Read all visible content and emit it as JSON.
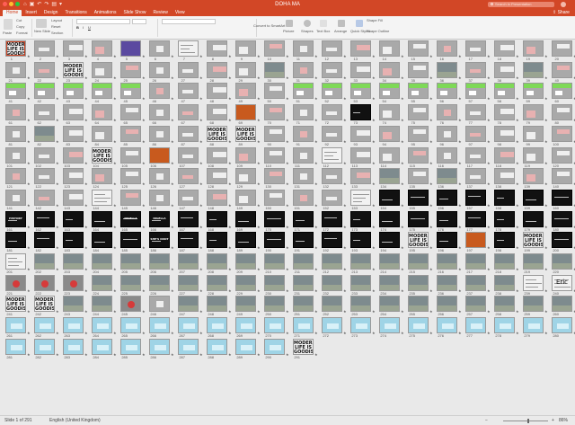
{
  "window": {
    "title": "DOHA MA",
    "search_placeholder": "Search in Presentation",
    "qat_icons": [
      "home-icon",
      "save-icon",
      "undo-icon",
      "redo-icon",
      "print-icon",
      "more-icon"
    ]
  },
  "tabs": [
    "Home",
    "Insert",
    "Design",
    "Transitions",
    "Animations",
    "Slide Show",
    "Review",
    "View"
  ],
  "active_tab": "Home",
  "share_label": "Share",
  "ribbon": {
    "paste": "Paste",
    "cut": "Cut",
    "copy": "Copy",
    "format": "Format",
    "new_slide": "New Slide",
    "layout": "Layout",
    "reset": "Reset",
    "section": "Section",
    "convert_smartart": "Convert to SmartArt",
    "picture": "Picture",
    "shapes": "Shapes",
    "text_box": "Text Box",
    "arrange": "Arrange",
    "quick_styles": "Quick Styles",
    "shape_fill": "Shape Fill",
    "shape_outline": "Shape Outline"
  },
  "status": {
    "slide_info": "Slide 1 of 291",
    "language": "English (United Kingdom)",
    "zoom": "86%",
    "zoom_fraction": 0.55
  },
  "thumb_style": {
    "gray": "#a9a9a9",
    "dark": "#111111",
    "green": "#7ed957",
    "orange": "#c85a1e",
    "blue": "#9fd4e6",
    "white": "#f2f2f2",
    "red": "#d63a3a"
  },
  "slides": [
    {
      "num": "1",
      "t": "modern"
    },
    {
      "num": "2",
      "t": "gray"
    },
    {
      "num": "3",
      "t": "gray"
    },
    {
      "num": "4",
      "t": "gray"
    },
    {
      "num": "5",
      "t": "purple"
    },
    {
      "num": "6",
      "t": "gray"
    },
    {
      "num": "7",
      "t": "white"
    },
    {
      "num": "8",
      "t": "gray"
    },
    {
      "num": "9",
      "t": "gray"
    },
    {
      "num": "10",
      "t": "gray"
    },
    {
      "num": "11",
      "t": "gray"
    },
    {
      "num": "12",
      "t": "gray"
    },
    {
      "num": "13",
      "t": "gray"
    },
    {
      "num": "14",
      "t": "gray"
    },
    {
      "num": "15",
      "t": "gray"
    },
    {
      "num": "16",
      "t": "gray"
    },
    {
      "num": "17",
      "t": "gray"
    },
    {
      "num": "18",
      "t": "gray"
    },
    {
      "num": "19",
      "t": "gray"
    },
    {
      "num": "20",
      "t": "gray"
    },
    {
      "num": "21",
      "t": "gray"
    },
    {
      "num": "22",
      "t": "gray"
    },
    {
      "num": "23",
      "t": "modern"
    },
    {
      "num": "24",
      "t": "gray"
    },
    {
      "num": "25",
      "t": "gray"
    },
    {
      "num": "26",
      "t": "gray"
    },
    {
      "num": "27",
      "t": "gray"
    },
    {
      "num": "28",
      "t": "gray"
    },
    {
      "num": "29",
      "t": "gray"
    },
    {
      "num": "30",
      "t": "photo"
    },
    {
      "num": "31",
      "t": "gray"
    },
    {
      "num": "32",
      "t": "gray"
    },
    {
      "num": "33",
      "t": "gray"
    },
    {
      "num": "34",
      "t": "gray"
    },
    {
      "num": "35",
      "t": "gray"
    },
    {
      "num": "36",
      "t": "photo"
    },
    {
      "num": "37",
      "t": "gray"
    },
    {
      "num": "38",
      "t": "gray"
    },
    {
      "num": "39",
      "t": "photo"
    },
    {
      "num": "40",
      "t": "gray"
    },
    {
      "num": "41",
      "t": "green"
    },
    {
      "num": "42",
      "t": "green"
    },
    {
      "num": "43",
      "t": "green"
    },
    {
      "num": "44",
      "t": "green"
    },
    {
      "num": "45",
      "t": "green"
    },
    {
      "num": "46",
      "t": "gray"
    },
    {
      "num": "47",
      "t": "gray"
    },
    {
      "num": "48",
      "t": "gray"
    },
    {
      "num": "49",
      "t": "gray"
    },
    {
      "num": "50",
      "t": "gray"
    },
    {
      "num": "51",
      "t": "green"
    },
    {
      "num": "52",
      "t": "green"
    },
    {
      "num": "53",
      "t": "green"
    },
    {
      "num": "54",
      "t": "green"
    },
    {
      "num": "55",
      "t": "green"
    },
    {
      "num": "56",
      "t": "green"
    },
    {
      "num": "57",
      "t": "green"
    },
    {
      "num": "58",
      "t": "green"
    },
    {
      "num": "59",
      "t": "green"
    },
    {
      "num": "60",
      "t": "green"
    },
    {
      "num": "61",
      "t": "gray"
    },
    {
      "num": "62",
      "t": "gray"
    },
    {
      "num": "63",
      "t": "gray"
    },
    {
      "num": "64",
      "t": "gray"
    },
    {
      "num": "65",
      "t": "gray"
    },
    {
      "num": "66",
      "t": "gray"
    },
    {
      "num": "67",
      "t": "gray"
    },
    {
      "num": "68",
      "t": "gray"
    },
    {
      "num": "69",
      "t": "orange"
    },
    {
      "num": "70",
      "t": "gray"
    },
    {
      "num": "71",
      "t": "gray"
    },
    {
      "num": "72",
      "t": "gray"
    },
    {
      "num": "73",
      "t": "dark"
    },
    {
      "num": "74",
      "t": "gray"
    },
    {
      "num": "75",
      "t": "gray"
    },
    {
      "num": "76",
      "t": "gray"
    },
    {
      "num": "77",
      "t": "gray"
    },
    {
      "num": "78",
      "t": "gray"
    },
    {
      "num": "79",
      "t": "gray"
    },
    {
      "num": "80",
      "t": "gray"
    },
    {
      "num": "81",
      "t": "gray"
    },
    {
      "num": "82",
      "t": "photo"
    },
    {
      "num": "83",
      "t": "gray"
    },
    {
      "num": "84",
      "t": "gray"
    },
    {
      "num": "85",
      "t": "gray"
    },
    {
      "num": "86",
      "t": "gray"
    },
    {
      "num": "87",
      "t": "gray"
    },
    {
      "num": "88",
      "t": "modern"
    },
    {
      "num": "89",
      "t": "modern"
    },
    {
      "num": "90",
      "t": "gray"
    },
    {
      "num": "91",
      "t": "gray"
    },
    {
      "num": "92",
      "t": "gray"
    },
    {
      "num": "93",
      "t": "gray"
    },
    {
      "num": "94",
      "t": "gray"
    },
    {
      "num": "95",
      "t": "gray"
    },
    {
      "num": "96",
      "t": "gray"
    },
    {
      "num": "97",
      "t": "gray"
    },
    {
      "num": "98",
      "t": "gray"
    },
    {
      "num": "99",
      "t": "gray"
    },
    {
      "num": "100",
      "t": "gray"
    },
    {
      "num": "101",
      "t": "gray"
    },
    {
      "num": "102",
      "t": "gray"
    },
    {
      "num": "103",
      "t": "gray"
    },
    {
      "num": "104",
      "t": "modern"
    },
    {
      "num": "105",
      "t": "gray"
    },
    {
      "num": "106",
      "t": "orange"
    },
    {
      "num": "107",
      "t": "gray"
    },
    {
      "num": "108",
      "t": "gray"
    },
    {
      "num": "109",
      "t": "gray"
    },
    {
      "num": "110",
      "t": "gray"
    },
    {
      "num": "111",
      "t": "gray"
    },
    {
      "num": "112",
      "t": "white"
    },
    {
      "num": "113",
      "t": "gray"
    },
    {
      "num": "114",
      "t": "gray"
    },
    {
      "num": "115",
      "t": "gray"
    },
    {
      "num": "116",
      "t": "gray"
    },
    {
      "num": "117",
      "t": "gray"
    },
    {
      "num": "118",
      "t": "gray"
    },
    {
      "num": "119",
      "t": "gray"
    },
    {
      "num": "120",
      "t": "gray"
    },
    {
      "num": "121",
      "t": "gray"
    },
    {
      "num": "122",
      "t": "gray"
    },
    {
      "num": "123",
      "t": "gray"
    },
    {
      "num": "124",
      "t": "gray"
    },
    {
      "num": "125",
      "t": "gray"
    },
    {
      "num": "126",
      "t": "gray"
    },
    {
      "num": "127",
      "t": "gray"
    },
    {
      "num": "128",
      "t": "gray"
    },
    {
      "num": "129",
      "t": "gray"
    },
    {
      "num": "130",
      "t": "gray"
    },
    {
      "num": "131",
      "t": "gray"
    },
    {
      "num": "132",
      "t": "gray"
    },
    {
      "num": "133",
      "t": "gray"
    },
    {
      "num": "134",
      "t": "photo"
    },
    {
      "num": "135",
      "t": "gray"
    },
    {
      "num": "136",
      "t": "photo"
    },
    {
      "num": "137",
      "t": "gray"
    },
    {
      "num": "138",
      "t": "gray"
    },
    {
      "num": "139",
      "t": "gray"
    },
    {
      "num": "140",
      "t": "gray"
    },
    {
      "num": "141",
      "t": "gray"
    },
    {
      "num": "142",
      "t": "gray"
    },
    {
      "num": "143",
      "t": "gray"
    },
    {
      "num": "144",
      "t": "white"
    },
    {
      "num": "145",
      "t": "gray"
    },
    {
      "num": "146",
      "t": "gray"
    },
    {
      "num": "147",
      "t": "gray"
    },
    {
      "num": "148",
      "t": "gray"
    },
    {
      "num": "149",
      "t": "gray"
    },
    {
      "num": "150",
      "t": "gray"
    },
    {
      "num": "151",
      "t": "gray"
    },
    {
      "num": "152",
      "t": "gray"
    },
    {
      "num": "153",
      "t": "white"
    },
    {
      "num": "154",
      "t": "dark"
    },
    {
      "num": "155",
      "t": "dark"
    },
    {
      "num": "156",
      "t": "dark"
    },
    {
      "num": "157",
      "t": "dark"
    },
    {
      "num": "158",
      "t": "dark"
    },
    {
      "num": "159",
      "t": "dark"
    },
    {
      "num": "160",
      "t": "dark"
    },
    {
      "num": "161",
      "t": "dark",
      "txt": "HISTORY"
    },
    {
      "num": "162",
      "t": "dark"
    },
    {
      "num": "163",
      "t": "dark"
    },
    {
      "num": "164",
      "t": "dark"
    },
    {
      "num": "165",
      "t": "dark",
      "txt": "NIGELLA"
    },
    {
      "num": "166",
      "t": "dark",
      "txt": "NIGELLA"
    },
    {
      "num": "167",
      "t": "dark"
    },
    {
      "num": "168",
      "t": "dark"
    },
    {
      "num": "169",
      "t": "dark"
    },
    {
      "num": "170",
      "t": "dark"
    },
    {
      "num": "171",
      "t": "dark"
    },
    {
      "num": "172",
      "t": "dark"
    },
    {
      "num": "173",
      "t": "dark"
    },
    {
      "num": "174",
      "t": "dark"
    },
    {
      "num": "175",
      "t": "dark"
    },
    {
      "num": "176",
      "t": "dark"
    },
    {
      "num": "177",
      "t": "dark"
    },
    {
      "num": "178",
      "t": "dark"
    },
    {
      "num": "179",
      "t": "dark"
    },
    {
      "num": "180",
      "t": "dark"
    },
    {
      "num": "181",
      "t": "dark"
    },
    {
      "num": "182",
      "t": "dark"
    },
    {
      "num": "183",
      "t": "dark"
    },
    {
      "num": "184",
      "t": "dark"
    },
    {
      "num": "185",
      "t": "dark"
    },
    {
      "num": "186",
      "t": "dark",
      "txt": "SHE'S IDIOT"
    },
    {
      "num": "187",
      "t": "dark"
    },
    {
      "num": "188",
      "t": "dark"
    },
    {
      "num": "189",
      "t": "dark"
    },
    {
      "num": "190",
      "t": "dark"
    },
    {
      "num": "191",
      "t": "dark"
    },
    {
      "num": "192",
      "t": "dark"
    },
    {
      "num": "193",
      "t": "dark"
    },
    {
      "num": "194",
      "t": "dark"
    },
    {
      "num": "195",
      "t": "modern"
    },
    {
      "num": "196",
      "t": "dark"
    },
    {
      "num": "197",
      "t": "orange"
    },
    {
      "num": "198",
      "t": "dark"
    },
    {
      "num": "199",
      "t": "modern"
    },
    {
      "num": "200",
      "t": "dark"
    },
    {
      "num": "201",
      "t": "white"
    },
    {
      "num": "202",
      "t": "photo"
    },
    {
      "num": "203",
      "t": "photo"
    },
    {
      "num": "204",
      "t": "photo"
    },
    {
      "num": "205",
      "t": "photo"
    },
    {
      "num": "206",
      "t": "photo"
    },
    {
      "num": "207",
      "t": "photo"
    },
    {
      "num": "208",
      "t": "photo"
    },
    {
      "num": "209",
      "t": "photo"
    },
    {
      "num": "210",
      "t": "photo"
    },
    {
      "num": "211",
      "t": "photo"
    },
    {
      "num": "212",
      "t": "photo"
    },
    {
      "num": "213",
      "t": "photo"
    },
    {
      "num": "214",
      "t": "photo"
    },
    {
      "num": "215",
      "t": "photo"
    },
    {
      "num": "216",
      "t": "photo"
    },
    {
      "num": "217",
      "t": "photo"
    },
    {
      "num": "218",
      "t": "photo"
    },
    {
      "num": "219",
      "t": "photo"
    },
    {
      "num": "220",
      "t": "photo"
    },
    {
      "num": "221",
      "t": "redball"
    },
    {
      "num": "222",
      "t": "redball"
    },
    {
      "num": "223",
      "t": "redball"
    },
    {
      "num": "224",
      "t": "photo"
    },
    {
      "num": "225",
      "t": "photo"
    },
    {
      "num": "226",
      "t": "photo"
    },
    {
      "num": "227",
      "t": "photo"
    },
    {
      "num": "228",
      "t": "photo"
    },
    {
      "num": "229",
      "t": "photo"
    },
    {
      "num": "230",
      "t": "photo"
    },
    {
      "num": "231",
      "t": "photo"
    },
    {
      "num": "232",
      "t": "photo"
    },
    {
      "num": "233",
      "t": "photo"
    },
    {
      "num": "234",
      "t": "photo"
    },
    {
      "num": "235",
      "t": "photo"
    },
    {
      "num": "236",
      "t": "photo"
    },
    {
      "num": "237",
      "t": "photo"
    },
    {
      "num": "238",
      "t": "photo"
    },
    {
      "num": "239",
      "t": "white"
    },
    {
      "num": "240",
      "t": "white",
      "txt": "Eric"
    },
    {
      "num": "241",
      "t": "modern"
    },
    {
      "num": "242",
      "t": "modern"
    },
    {
      "num": "243",
      "t": "photo"
    },
    {
      "num": "244",
      "t": "photo"
    },
    {
      "num": "245",
      "t": "redball"
    },
    {
      "num": "246",
      "t": "gray"
    },
    {
      "num": "247",
      "t": "photo"
    },
    {
      "num": "248",
      "t": "photo"
    },
    {
      "num": "249",
      "t": "photo"
    },
    {
      "num": "250",
      "t": "photo"
    },
    {
      "num": "251",
      "t": "photo"
    },
    {
      "num": "252",
      "t": "photo"
    },
    {
      "num": "253",
      "t": "photo"
    },
    {
      "num": "254",
      "t": "photo"
    },
    {
      "num": "255",
      "t": "photo"
    },
    {
      "num": "256",
      "t": "photo"
    },
    {
      "num": "257",
      "t": "photo"
    },
    {
      "num": "258",
      "t": "photo"
    },
    {
      "num": "259",
      "t": "photo"
    },
    {
      "num": "260",
      "t": "photo"
    },
    {
      "num": "261",
      "t": "blue"
    },
    {
      "num": "262",
      "t": "blue"
    },
    {
      "num": "263",
      "t": "blue"
    },
    {
      "num": "264",
      "t": "blue"
    },
    {
      "num": "265",
      "t": "blue"
    },
    {
      "num": "266",
      "t": "blue"
    },
    {
      "num": "267",
      "t": "blue"
    },
    {
      "num": "268",
      "t": "blue"
    },
    {
      "num": "269",
      "t": "blue"
    },
    {
      "num": "270",
      "t": "blue"
    },
    {
      "num": "271",
      "t": "blue"
    },
    {
      "num": "272",
      "t": "blue"
    },
    {
      "num": "273",
      "t": "blue"
    },
    {
      "num": "274",
      "t": "blue"
    },
    {
      "num": "275",
      "t": "blue"
    },
    {
      "num": "276",
      "t": "blue"
    },
    {
      "num": "277",
      "t": "blue"
    },
    {
      "num": "278",
      "t": "blue"
    },
    {
      "num": "279",
      "t": "blue"
    },
    {
      "num": "280",
      "t": "blue"
    },
    {
      "num": "281",
      "t": "blue"
    },
    {
      "num": "282",
      "t": "blue"
    },
    {
      "num": "283",
      "t": "blue"
    },
    {
      "num": "284",
      "t": "blue"
    },
    {
      "num": "285",
      "t": "blue"
    },
    {
      "num": "286",
      "t": "blue"
    },
    {
      "num": "287",
      "t": "blue"
    },
    {
      "num": "288",
      "t": "blue"
    },
    {
      "num": "289",
      "t": "blue"
    },
    {
      "num": "290",
      "t": "blue"
    },
    {
      "num": "291",
      "t": "modern"
    }
  ],
  "modern_label": "MODERN LIFE IS GOODISH"
}
